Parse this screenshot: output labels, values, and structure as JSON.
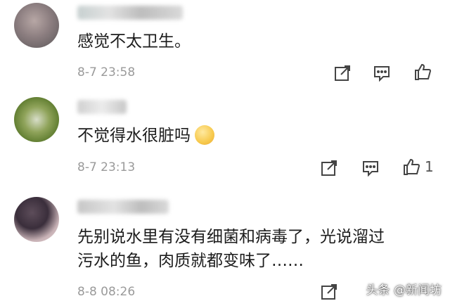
{
  "comments": [
    {
      "username": "",
      "text": "感觉不太卫生。",
      "time": "8-7 23:58",
      "likes": ""
    },
    {
      "username": "",
      "text": "不觉得水很脏吗",
      "time": "8-7 23:13",
      "likes": "1"
    },
    {
      "username": "",
      "text": "先别说水里有没有细菌和病毒了，光说溜过\n污水的鱼，肉质就都变味了……",
      "time": "8-8 08:26",
      "likes": ""
    }
  ],
  "watermark": "头条 @新闻坊",
  "icons": {
    "share": "share-icon",
    "reply": "comment-icon",
    "like": "thumbs-up-icon",
    "emoji": "shush-emoji-icon"
  }
}
